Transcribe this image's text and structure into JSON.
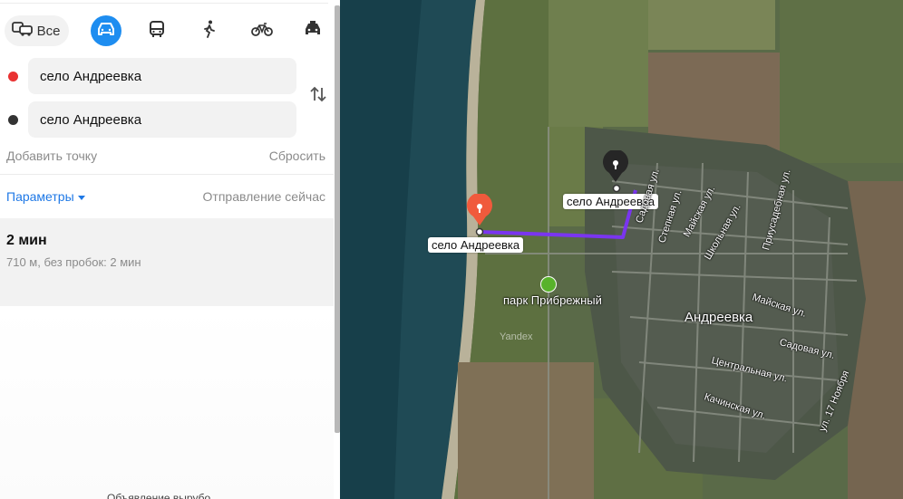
{
  "modes": {
    "all_label": "Все",
    "items": [
      {
        "name": "car-mode",
        "icon": "car-icon",
        "active": true
      },
      {
        "name": "transit-mode",
        "icon": "bus-icon"
      },
      {
        "name": "walk-mode",
        "icon": "walking-icon"
      },
      {
        "name": "bike-mode",
        "icon": "bicycle-icon"
      },
      {
        "name": "taxi-mode",
        "icon": "taxi-icon"
      }
    ]
  },
  "route_form": {
    "from_value": "село Андреевка",
    "to_value": "село Андреевка",
    "add_point": "Добавить точку",
    "reset": "Сбросить"
  },
  "options": {
    "params": "Параметры",
    "depart": "Отправление сейчас"
  },
  "route": {
    "time": "2 мин",
    "details": "710 м, без пробок: 2 мин"
  },
  "bottom_text": "Объявление вырубо",
  "map": {
    "from_label": "село Андреевка",
    "to_label": "село Андреевка",
    "park": "парк Прибрежный",
    "town": "Андреевка",
    "watermark": "Yandex",
    "streets": [
      "Садовая ул.",
      "Степная ул.",
      "Майская ул.",
      "Школьная ул.",
      "Приусадебная ул.",
      "Майская ул.",
      "Садовая ул.",
      "Центральная ул.",
      "Качинская ул.",
      "ул. 17 Ноября"
    ],
    "route_color": "#7a35f0",
    "pin_red": "#f05a3c",
    "pin_black": "#262626"
  }
}
